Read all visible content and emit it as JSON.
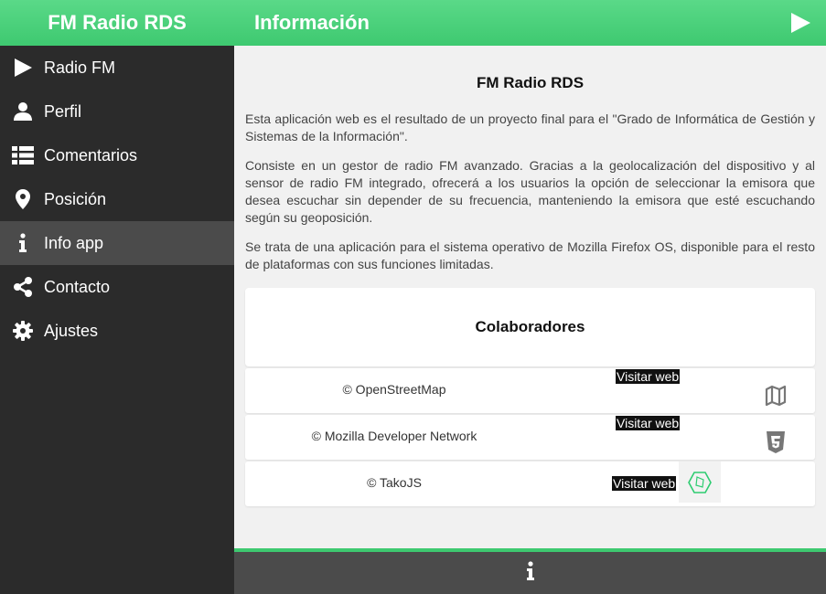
{
  "sidebar": {
    "title": "FM Radio RDS",
    "items": [
      {
        "label": "Radio FM",
        "icon": "play-icon"
      },
      {
        "label": "Perfil",
        "icon": "user-icon"
      },
      {
        "label": "Comentarios",
        "icon": "list-icon"
      },
      {
        "label": "Posición",
        "icon": "map-marker-icon"
      },
      {
        "label": "Info app",
        "icon": "info-icon",
        "active": true
      },
      {
        "label": "Contacto",
        "icon": "share-icon"
      },
      {
        "label": "Ajustes",
        "icon": "gear-icon"
      }
    ]
  },
  "header": {
    "title": "Información",
    "action_icon": "play-icon"
  },
  "main": {
    "heading": "FM Radio RDS",
    "paragraphs": [
      "Esta aplicación web es el resultado de un proyecto final para el \"Grado de Informática de Gestión y Sistemas de la Información\".",
      "Consiste en un gestor de radio FM avanzado. Gracias a la geolocalización del dispositivo y al sensor de radio FM integrado, ofrecerá a los usuarios la opción de seleccionar la emisora que desea escuchar sin depender de su frecuencia, manteniendo la emisora que esté escuchando según su geoposición.",
      "Se trata de una aplicación para el sistema operativo de Mozilla Firefox OS, disponible para el resto de plataformas con sus funciones limitadas."
    ],
    "collaborators_title": "Colaboradores",
    "collaborators": [
      {
        "name": "© OpenStreetMap",
        "link_label": "Visitar web",
        "icon": "map-icon"
      },
      {
        "name": "© Mozilla Developer Network",
        "link_label": "Visitar web",
        "icon": "html5-icon"
      },
      {
        "name": "© TakoJS",
        "link_label": "Visitar web",
        "icon": "takojs-logo-icon"
      }
    ]
  },
  "footer": {
    "icon": "info-icon"
  },
  "colors": {
    "accent": "#3ec970",
    "sidebar_bg": "#2b2b2b",
    "active_bg": "#4b4b4b"
  }
}
